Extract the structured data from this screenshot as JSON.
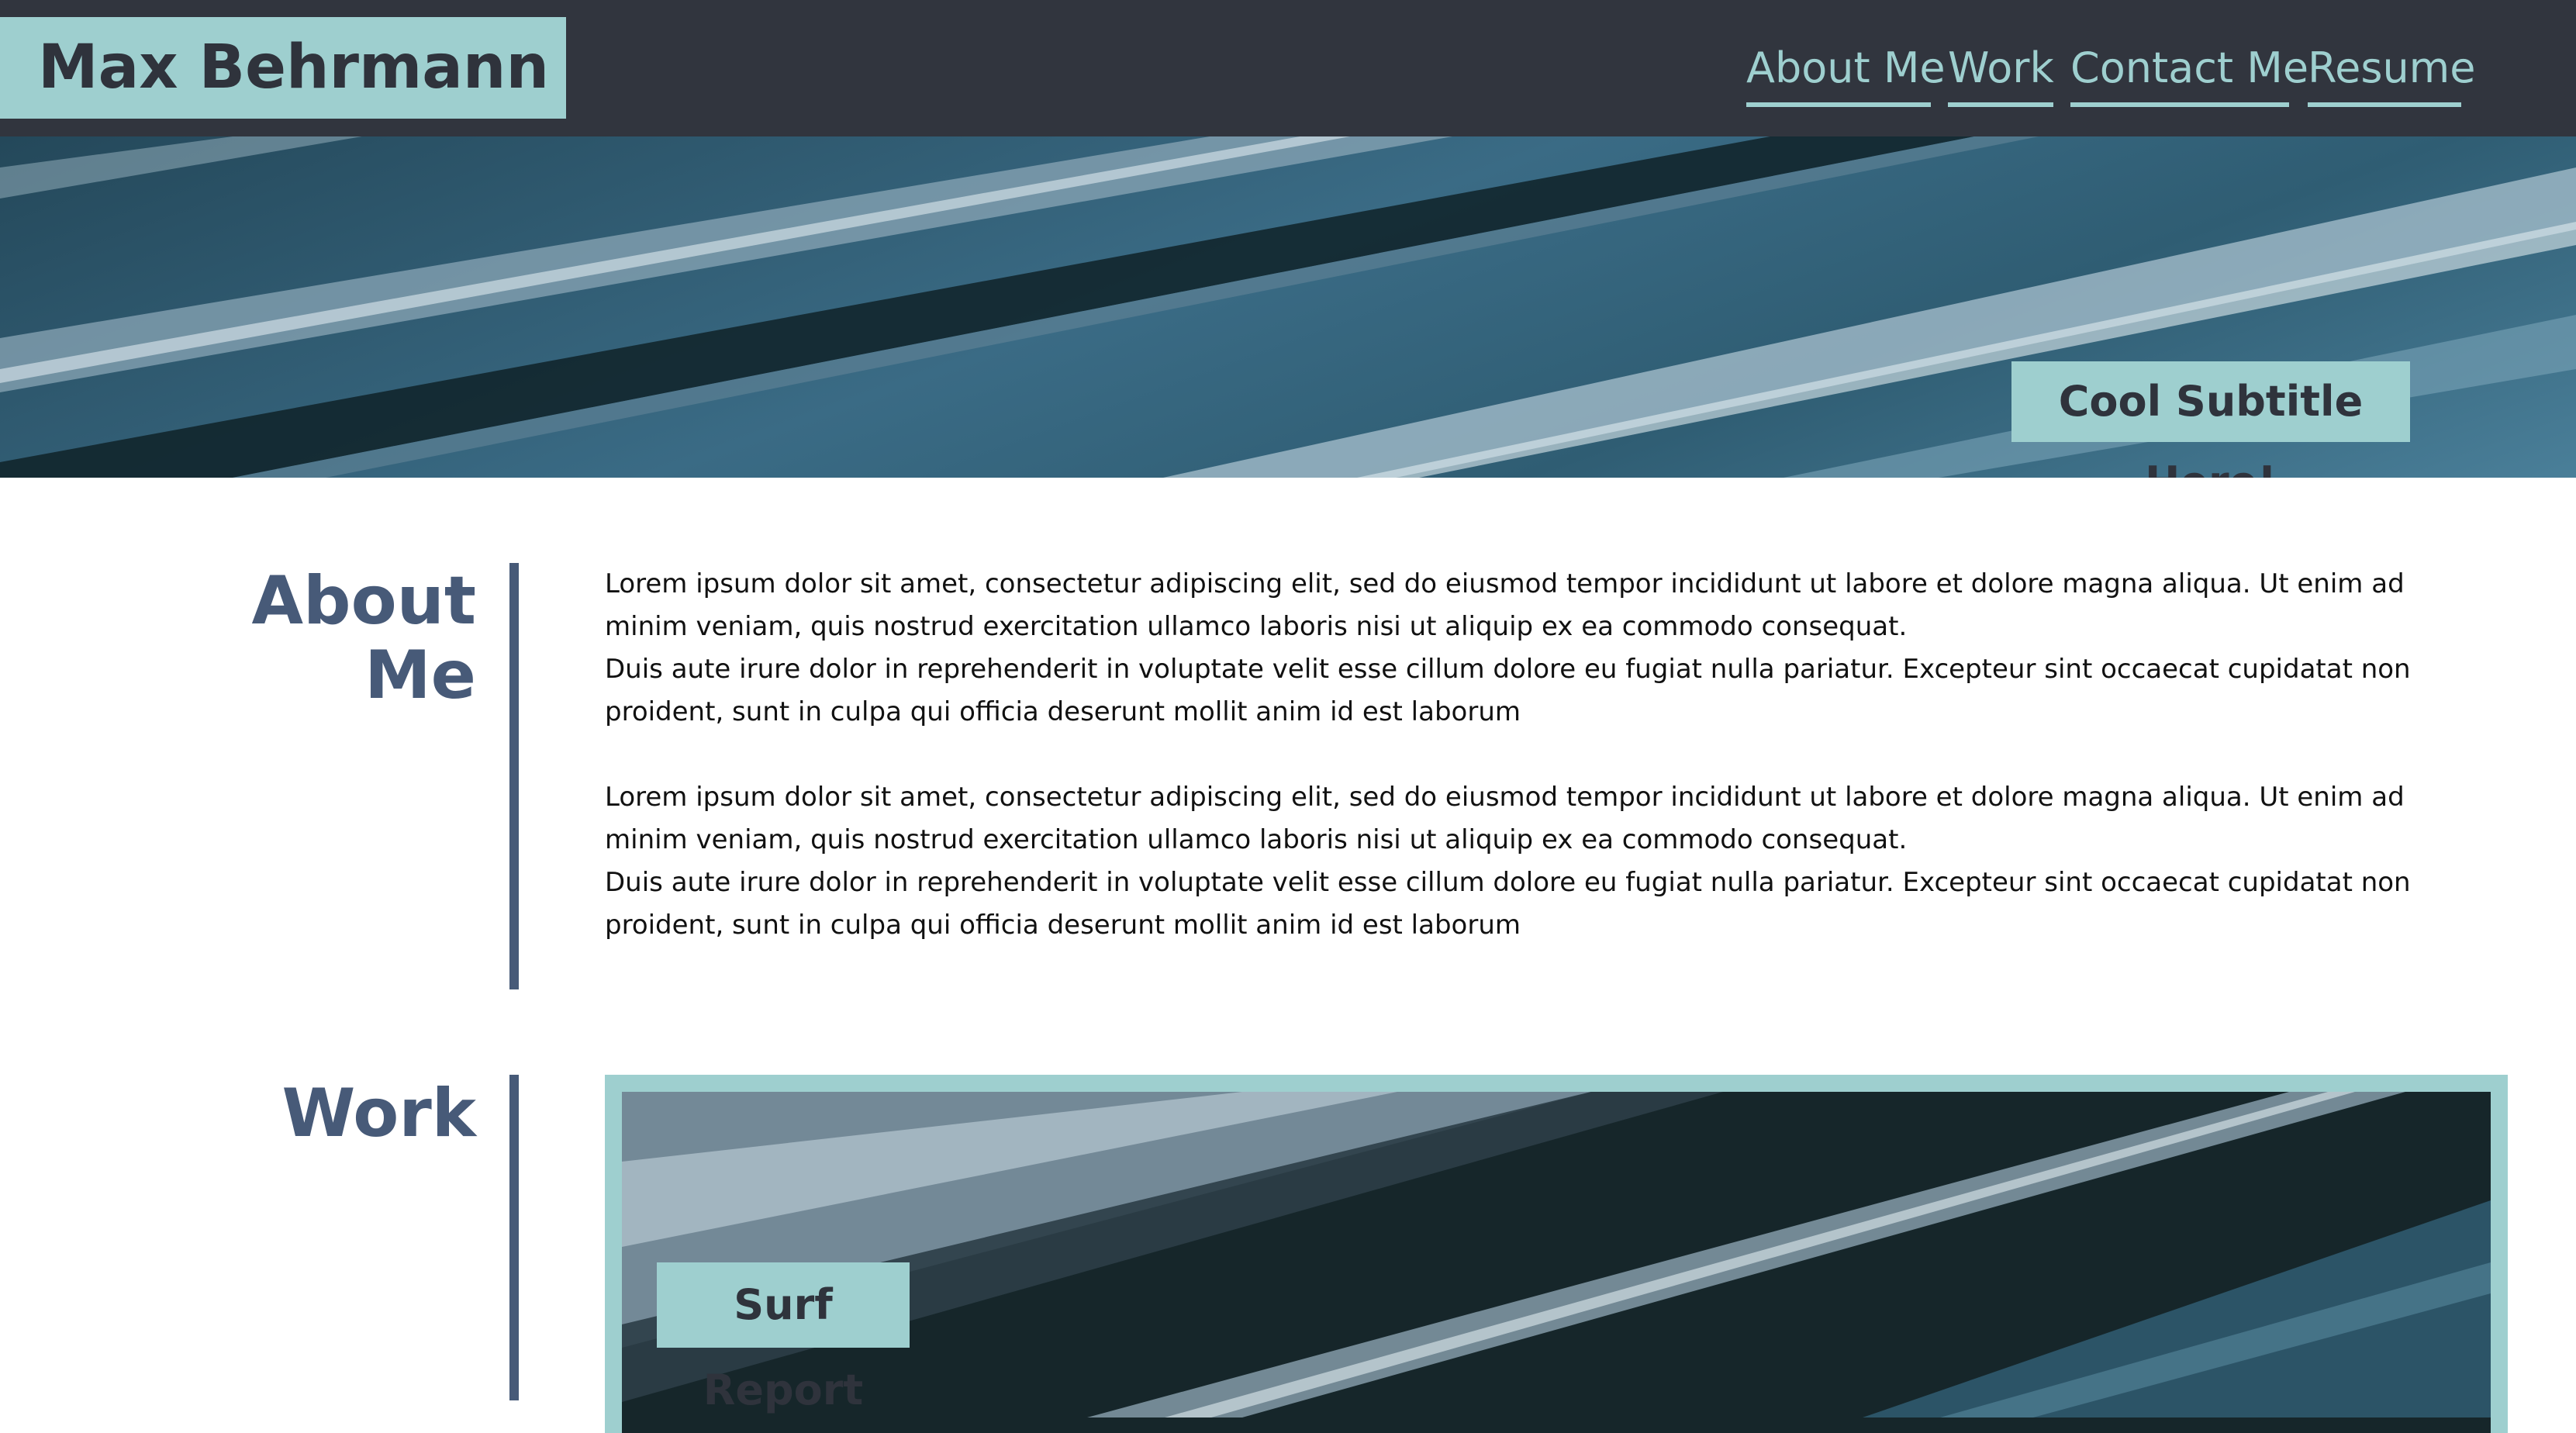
{
  "header": {
    "brand": "Max Behrmann",
    "nav": [
      {
        "label": "About Me"
      },
      {
        "label": "Work"
      },
      {
        "label": "Contact Me"
      },
      {
        "label": "Resume"
      }
    ]
  },
  "hero": {
    "subtitle": "Cool Subtitle Here!"
  },
  "about": {
    "title_line1": "About",
    "title_line2": "Me",
    "paragraphs": [
      "Lorem ipsum dolor sit amet, consectetur adipiscing elit, sed do eiusmod tempor incididunt ut labore et dolore magna aliqua. Ut enim ad minim veniam, quis nostrud exercitation ullamco laboris nisi ut aliquip ex ea commodo consequat.",
      "Duis aute irure dolor in reprehenderit in voluptate velit esse cillum dolore eu fugiat nulla pariatur. Excepteur sint occaecat cupidatat non proident, sunt in culpa qui officia deserunt mollit anim id est laborum",
      "Lorem ipsum dolor sit amet, consectetur adipiscing elit, sed do eiusmod tempor incididunt ut labore et dolore magna aliqua. Ut enim ad minim veniam, quis nostrud exercitation ullamco laboris nisi ut aliquip ex ea commodo consequat.",
      "Duis aute irure dolor in reprehenderit in voluptate velit esse cillum dolore eu fugiat nulla pariatur. Excepteur sint occaecat cupidatat non proident, sunt in culpa qui officia deserunt mollit anim id est laborum"
    ]
  },
  "work": {
    "title": "Work",
    "cards": [
      {
        "label": "Surf Report"
      }
    ]
  },
  "colors": {
    "header_bg": "#31353e",
    "accent": "#9ecfcf",
    "heading": "#475a78"
  }
}
